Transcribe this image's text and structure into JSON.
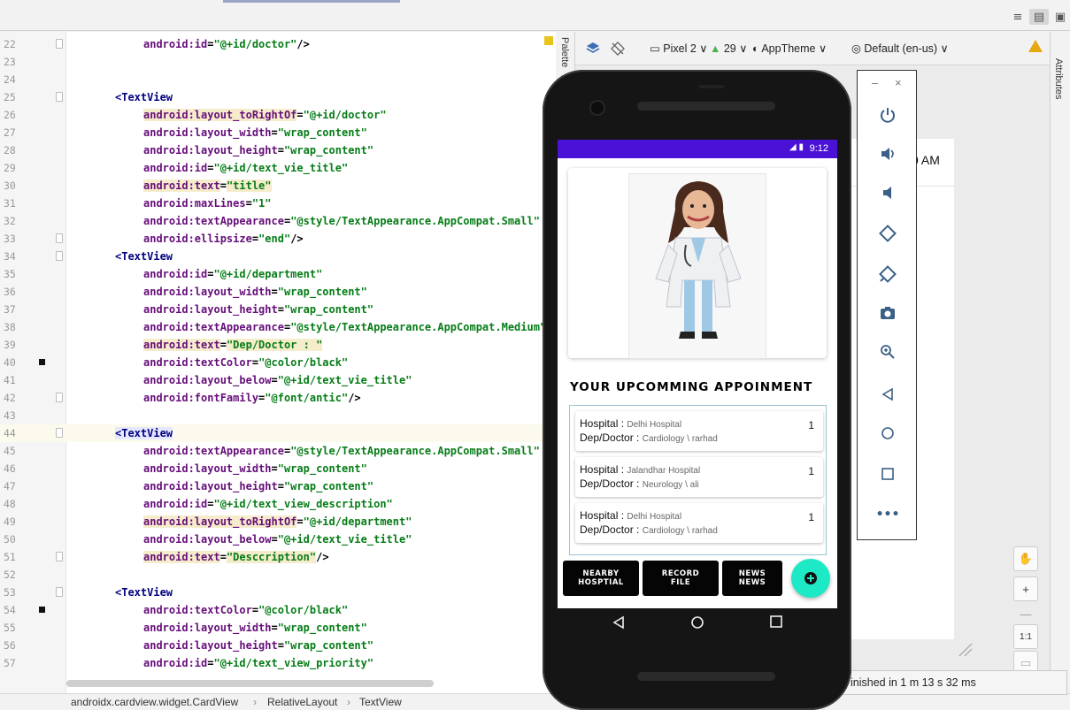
{
  "view_modes": [
    "code",
    "split",
    "design"
  ],
  "editor": {
    "lines": [
      {
        "n": "22",
        "parts": [
          [
            "attr",
            "android:id"
          ],
          [
            "pun",
            "="
          ],
          [
            "val",
            "\"@+id/doctor\""
          ],
          [
            "pun",
            "/>"
          ]
        ],
        "indent": 2
      },
      {
        "n": "23",
        "parts": []
      },
      {
        "n": "24",
        "parts": []
      },
      {
        "n": "25",
        "parts": [
          [
            "tag",
            "<TextView"
          ]
        ],
        "indent": 1
      },
      {
        "n": "26",
        "parts": [
          [
            "attr-h",
            "android:layout_toRightOf"
          ],
          [
            "pun",
            "="
          ],
          [
            "val",
            "\"@+id/doctor\""
          ]
        ],
        "indent": 2
      },
      {
        "n": "27",
        "parts": [
          [
            "attr",
            "android:layout_width"
          ],
          [
            "pun",
            "="
          ],
          [
            "val",
            "\"wrap_content\""
          ]
        ],
        "indent": 2
      },
      {
        "n": "28",
        "parts": [
          [
            "attr",
            "android:layout_height"
          ],
          [
            "pun",
            "="
          ],
          [
            "val",
            "\"wrap_content\""
          ]
        ],
        "indent": 2
      },
      {
        "n": "29",
        "parts": [
          [
            "attr",
            "android:id"
          ],
          [
            "pun",
            "="
          ],
          [
            "val",
            "\"@+id/text_vie_title\""
          ]
        ],
        "indent": 2
      },
      {
        "n": "30",
        "parts": [
          [
            "attr-h",
            "android:text"
          ],
          [
            "pun",
            "="
          ],
          [
            "val-h",
            "\"title\""
          ]
        ],
        "indent": 2
      },
      {
        "n": "31",
        "parts": [
          [
            "attr",
            "android:maxLines"
          ],
          [
            "pun",
            "="
          ],
          [
            "val",
            "\"1\""
          ]
        ],
        "indent": 2
      },
      {
        "n": "32",
        "parts": [
          [
            "attr",
            "android:textAppearance"
          ],
          [
            "pun",
            "="
          ],
          [
            "val",
            "\"@style/TextAppearance.AppCompat.Small\""
          ]
        ],
        "indent": 2
      },
      {
        "n": "33",
        "parts": [
          [
            "attr",
            "android:ellipsize"
          ],
          [
            "pun",
            "="
          ],
          [
            "val",
            "\"end\""
          ],
          [
            "pun",
            "/>"
          ]
        ],
        "indent": 2
      },
      {
        "n": "34",
        "parts": [
          [
            "tag",
            "<TextView"
          ]
        ],
        "indent": 1
      },
      {
        "n": "35",
        "parts": [
          [
            "attr",
            "android:id"
          ],
          [
            "pun",
            "="
          ],
          [
            "val",
            "\"@+id/department\""
          ]
        ],
        "indent": 2
      },
      {
        "n": "36",
        "parts": [
          [
            "attr",
            "android:layout_width"
          ],
          [
            "pun",
            "="
          ],
          [
            "val",
            "\"wrap_content\""
          ]
        ],
        "indent": 2
      },
      {
        "n": "37",
        "parts": [
          [
            "attr",
            "android:layout_height"
          ],
          [
            "pun",
            "="
          ],
          [
            "val",
            "\"wrap_content\""
          ]
        ],
        "indent": 2
      },
      {
        "n": "38",
        "parts": [
          [
            "attr",
            "android:textAppearance"
          ],
          [
            "pun",
            "="
          ],
          [
            "val",
            "\"@style/TextAppearance.AppCompat.Medium\""
          ]
        ],
        "indent": 2
      },
      {
        "n": "39",
        "parts": [
          [
            "attr-h",
            "android:text"
          ],
          [
            "pun",
            "="
          ],
          [
            "val-h",
            "\"Dep/Doctor : \""
          ]
        ],
        "indent": 2
      },
      {
        "n": "40",
        "parts": [
          [
            "attr",
            "android:textColor"
          ],
          [
            "pun",
            "="
          ],
          [
            "val",
            "\"@color/black\""
          ]
        ],
        "indent": 2,
        "bp": true
      },
      {
        "n": "41",
        "parts": [
          [
            "attr",
            "android:layout_below"
          ],
          [
            "pun",
            "="
          ],
          [
            "val",
            "\"@+id/text_vie_title\""
          ]
        ],
        "indent": 2
      },
      {
        "n": "42",
        "parts": [
          [
            "attr",
            "android:fontFamily"
          ],
          [
            "pun",
            "="
          ],
          [
            "val",
            "\"@font/antic\""
          ],
          [
            "pun",
            "/>"
          ]
        ],
        "indent": 2
      },
      {
        "n": "43",
        "parts": []
      },
      {
        "n": "44",
        "parts": [
          [
            "tag-s",
            "<TextView"
          ]
        ],
        "indent": 1,
        "hl": true
      },
      {
        "n": "45",
        "parts": [
          [
            "attr",
            "android:textAppearance"
          ],
          [
            "pun",
            "="
          ],
          [
            "val",
            "\"@style/TextAppearance.AppCompat.Small\""
          ]
        ],
        "indent": 2
      },
      {
        "n": "46",
        "parts": [
          [
            "attr",
            "android:layout_width"
          ],
          [
            "pun",
            "="
          ],
          [
            "val",
            "\"wrap_content\""
          ]
        ],
        "indent": 2
      },
      {
        "n": "47",
        "parts": [
          [
            "attr",
            "android:layout_height"
          ],
          [
            "pun",
            "="
          ],
          [
            "val",
            "\"wrap_content\""
          ]
        ],
        "indent": 2
      },
      {
        "n": "48",
        "parts": [
          [
            "attr",
            "android:id"
          ],
          [
            "pun",
            "="
          ],
          [
            "val",
            "\"@+id/text_view_description\""
          ]
        ],
        "indent": 2
      },
      {
        "n": "49",
        "parts": [
          [
            "attr-h",
            "android:layout_toRightOf"
          ],
          [
            "pun",
            "="
          ],
          [
            "val",
            "\"@+id/department\""
          ]
        ],
        "indent": 2
      },
      {
        "n": "50",
        "parts": [
          [
            "attr",
            "android:layout_below"
          ],
          [
            "pun",
            "="
          ],
          [
            "val",
            "\"@+id/text_vie_title\""
          ]
        ],
        "indent": 2
      },
      {
        "n": "51",
        "parts": [
          [
            "attr-h",
            "android:text"
          ],
          [
            "pun",
            "="
          ],
          [
            "val-h",
            "\"Desccription\""
          ],
          [
            "pun",
            "/>"
          ]
        ],
        "indent": 2
      },
      {
        "n": "52",
        "parts": []
      },
      {
        "n": "53",
        "parts": [
          [
            "tag",
            "<TextView"
          ]
        ],
        "indent": 1
      },
      {
        "n": "54",
        "parts": [
          [
            "attr",
            "android:textColor"
          ],
          [
            "pun",
            "="
          ],
          [
            "val",
            "\"@color/black\""
          ]
        ],
        "indent": 2,
        "bp": true
      },
      {
        "n": "55",
        "parts": [
          [
            "attr",
            "android:layout_width"
          ],
          [
            "pun",
            "="
          ],
          [
            "val",
            "\"wrap_content\""
          ]
        ],
        "indent": 2
      },
      {
        "n": "56",
        "parts": [
          [
            "attr",
            "android:layout_height"
          ],
          [
            "pun",
            "="
          ],
          [
            "val",
            "\"wrap_content\""
          ]
        ],
        "indent": 2
      },
      {
        "n": "57",
        "parts": [
          [
            "attr",
            "android:id"
          ],
          [
            "pun",
            "="
          ],
          [
            "val",
            "\"@+id/text_view_priority\""
          ]
        ],
        "indent": 2
      }
    ]
  },
  "breadcrumb": {
    "item1": "androidx.cardview.widget.CardView",
    "sep": "›",
    "item2": "RelativeLayout",
    "item3": "TextView"
  },
  "design_toolbar": {
    "palette": "Palette",
    "device": "Pixel 2",
    "api": "29",
    "theme": "AppTheme",
    "locale": "Default (en-us)",
    "attributes": "Attributes"
  },
  "canvas": {
    "time_fragment": "0 AM"
  },
  "zoom": {
    "plus": "+",
    "minus": "—",
    "ratio": "1:1"
  },
  "status_message": "inished in 1 m 13 s 32 ms",
  "phone": {
    "status_time": "9:12",
    "section_title": "YOUR UPCOMMING APPOINMENT",
    "appointments": [
      {
        "hospital_label": "Hospital",
        "hospital": "Delhi Hospital",
        "dep_label": "Dep/Doctor",
        "dep": "Cardiology \\ rarhad",
        "priority": "1"
      },
      {
        "hospital_label": "Hospital",
        "hospital": "Jalandhar Hospital",
        "dep_label": "Dep/Doctor",
        "dep": "Neurology \\ ali",
        "priority": "1"
      },
      {
        "hospital_label": "Hospital",
        "hospital": "Delhi Hospital",
        "dep_label": "Dep/Doctor",
        "dep": "Cardiology \\ rarhad",
        "priority": "1"
      }
    ],
    "nav_buttons": [
      {
        "line1": "NEARBY",
        "line2": "HOSPTIAL"
      },
      {
        "line1": "RECORD",
        "line2": "FILE"
      },
      {
        "line1": "NEWS",
        "line2": "NEWS"
      }
    ]
  },
  "emulator_controls": [
    "minimize",
    "close",
    "power",
    "volume-up",
    "volume-down",
    "rotate-left",
    "rotate-right",
    "screenshot",
    "zoom",
    "back",
    "home",
    "overview",
    "more"
  ],
  "colors": {
    "status_bar": "#4a12d6",
    "fab": "#1de9c6",
    "warning": "#e5a812"
  }
}
